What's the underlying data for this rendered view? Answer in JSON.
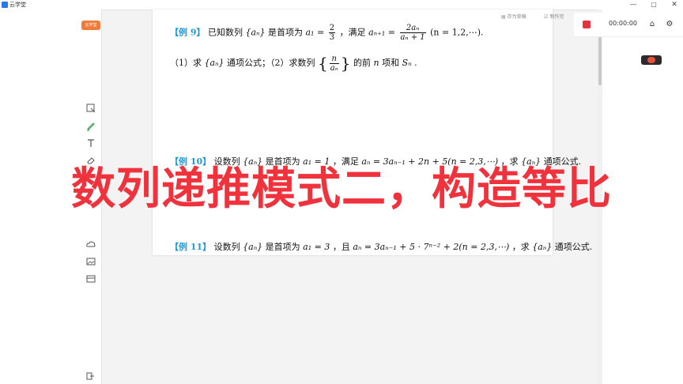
{
  "window": {
    "title": "云学堂",
    "minimize": "—",
    "maximize": "▢",
    "close": "✕"
  },
  "app_logo": {
    "label": "云学堂"
  },
  "toolbar": {
    "save_label": "存为草稿",
    "submit_label": "制作完"
  },
  "recorder": {
    "time": "00:00:00"
  },
  "left_tools": [
    {
      "name": "select-icon"
    },
    {
      "name": "pen-icon"
    },
    {
      "name": "text-icon"
    },
    {
      "name": "eraser-icon"
    },
    {
      "name": "cloud-icon"
    },
    {
      "name": "image-icon"
    },
    {
      "name": "card-icon"
    }
  ],
  "document": {
    "ex9": {
      "tag": "【例 9】",
      "intro": "已知数列",
      "seq": "{aₙ}",
      "cond": "是首项为",
      "a1": "a₁ =",
      "a1_num": "2",
      "a1_den": "3",
      "sep": "，满足",
      "rec_lhs": "aₙ₊₁ =",
      "rec_num": "2aₙ",
      "rec_den": "aₙ + 1",
      "range": "(n = 1,2,⋯).",
      "q_prefix": "（1）求",
      "q_seq": "{aₙ}",
      "q_mid": "通项公式；（2）求数列",
      "q_num": "n",
      "q_den": "aₙ",
      "q_suffix": "的前",
      "q_n": "n",
      "q_end": "项和",
      "q_S": "Sₙ",
      "q_dot": "."
    },
    "ex10": {
      "tag": "【例 10】",
      "text1": "设数列",
      "seq": "{aₙ}",
      "text2": "是首项为",
      "a1": "a₁ = 1",
      "text3": "，满足",
      "rec": "aₙ = 3aₙ₋₁ + 2n + 5(n = 2,3,⋯)",
      "text4": "，求",
      "seq2": "{aₙ}",
      "text5": "通项公式."
    },
    "ex11": {
      "tag": "【例 11】",
      "text1": "设数列",
      "seq": "{aₙ}",
      "text2": "是首项为",
      "a1": "a₁ = 3",
      "text3": "，且",
      "rec": "aₙ = 3aₙ₋₁ + 5 · 7ⁿ⁻² + 2(n = 2,3,⋯)",
      "text4": "，求",
      "seq2": "{aₙ}",
      "text5": "通项公式."
    }
  },
  "overlay_caption": "数列递推模式二，构造等比",
  "colors": {
    "overlay": "#f0323c",
    "example_tag": "#1e9bd7",
    "record_stop": "#e8333c",
    "logo": "#f07a3a"
  }
}
